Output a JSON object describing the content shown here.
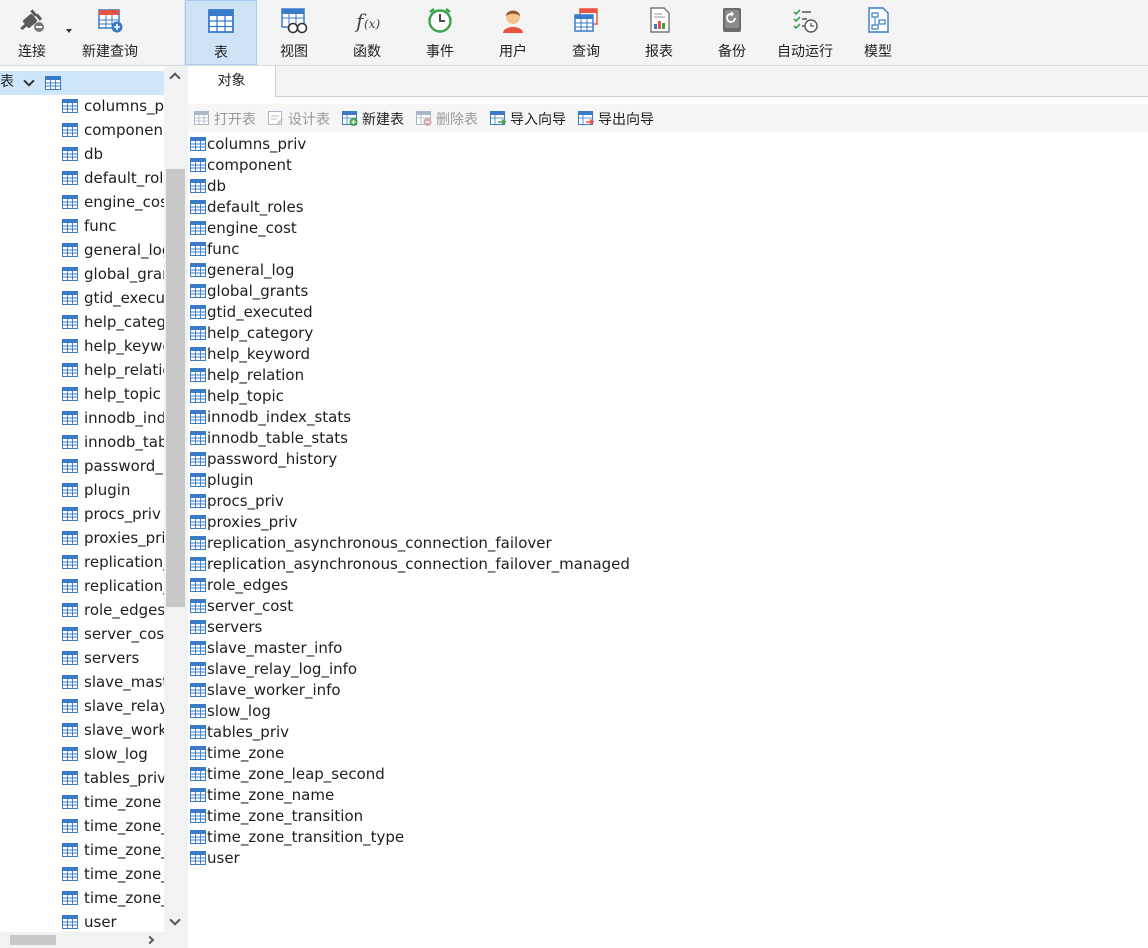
{
  "toolbar": {
    "buttons": [
      {
        "label": "连接",
        "icon": "plug-icon"
      },
      {
        "label": "新建查询",
        "icon": "new-query-icon"
      },
      {
        "label": "表",
        "icon": "table-icon",
        "active": true
      },
      {
        "label": "视图",
        "icon": "view-icon"
      },
      {
        "label": "函数",
        "icon": "function-icon"
      },
      {
        "label": "事件",
        "icon": "clock-icon"
      },
      {
        "label": "用户",
        "icon": "user-icon"
      },
      {
        "label": "查询",
        "icon": "query-icon"
      },
      {
        "label": "报表",
        "icon": "report-icon"
      },
      {
        "label": "备份",
        "icon": "backup-icon"
      },
      {
        "label": "自动运行",
        "icon": "schedule-icon"
      },
      {
        "label": "模型",
        "icon": "model-icon"
      }
    ]
  },
  "nav": {
    "header": "表",
    "items": [
      "columns_pr",
      "componen",
      "db",
      "default_role",
      "engine_cos",
      "func",
      "general_log",
      "global_gran",
      "gtid_execu",
      "help_categ",
      "help_keywo",
      "help_relatio",
      "help_topic",
      "innodb_ind",
      "innodb_tab",
      "password_h",
      "plugin",
      "procs_priv",
      "proxies_pri",
      "replication_",
      "replication_",
      "role_edges",
      "server_cost",
      "servers",
      "slave_maste",
      "slave_relay_",
      "slave_work",
      "slow_log",
      "tables_priv",
      "time_zone",
      "time_zone_",
      "time_zone_",
      "time_zone_",
      "time_zone_",
      "user"
    ]
  },
  "tabs": {
    "objects": "对象"
  },
  "objbar": {
    "open_table": "打开表",
    "design_table": "设计表",
    "new_table": "新建表",
    "delete_table": "删除表",
    "import_wizard": "导入向导",
    "export_wizard": "导出向导"
  },
  "objects": [
    "columns_priv",
    "component",
    "db",
    "default_roles",
    "engine_cost",
    "func",
    "general_log",
    "global_grants",
    "gtid_executed",
    "help_category",
    "help_keyword",
    "help_relation",
    "help_topic",
    "innodb_index_stats",
    "innodb_table_stats",
    "password_history",
    "plugin",
    "procs_priv",
    "proxies_priv",
    "replication_asynchronous_connection_failover",
    "replication_asynchronous_connection_failover_managed",
    "role_edges",
    "server_cost",
    "servers",
    "slave_master_info",
    "slave_relay_log_info",
    "slave_worker_info",
    "slow_log",
    "tables_priv",
    "time_zone",
    "time_zone_leap_second",
    "time_zone_name",
    "time_zone_transition",
    "time_zone_transition_type",
    "user"
  ],
  "colors": {
    "active_tab_bg": "#cfe3f7",
    "nav_selected_bg": "#cde6f9",
    "table_icon": "#3a7bc8"
  }
}
